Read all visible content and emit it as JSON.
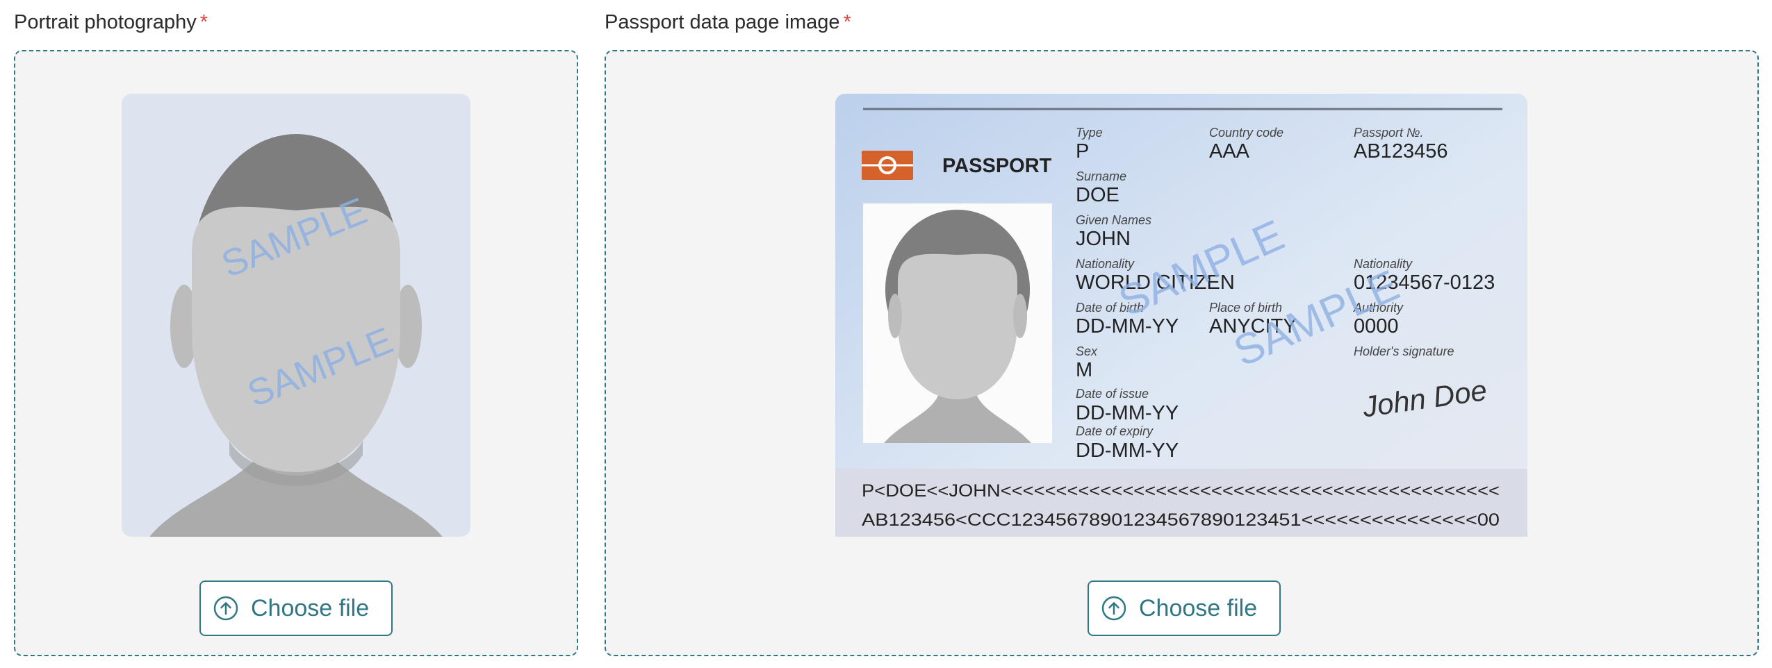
{
  "portrait": {
    "label": "Portrait photography",
    "required_mark": "*",
    "watermark": "SAMPLE",
    "button_label": "Choose file",
    "button_icon": "upload-arrow-circle-icon"
  },
  "passport": {
    "label": "Passport data page image",
    "required_mark": "*",
    "button_label": "Choose file",
    "button_icon": "upload-arrow-circle-icon",
    "document": {
      "title": "PASSPORT",
      "watermark": "SAMPLE",
      "type_label": "Type",
      "type_value": "P",
      "country_code_label": "Country code",
      "country_code_value": "AAA",
      "passport_no_label": "Passport №.",
      "passport_no_value": "AB123456",
      "surname_label": "Surname",
      "surname_value": "DOE",
      "given_names_label": "Given Names",
      "given_names_value": "JOHN",
      "nationality_label": "Nationality",
      "nationality_value": "WORLD CITIZEN",
      "personal_no_label": "Nationality",
      "personal_no_value": "01234567-0123",
      "dob_label": "Date of birth",
      "dob_value": "DD-MM-YY",
      "pob_label": "Place of birth",
      "pob_value": "ANYCITY",
      "authority_label": "Authority",
      "authority_value": "0000",
      "sex_label": "Sex",
      "sex_value": "M",
      "signature_label": "Holder's signature",
      "signature_value": "John Doe",
      "issue_label": "Date of issue",
      "issue_value": "DD-MM-YY",
      "expiry_label": "Date of expiry",
      "expiry_value": "DD-MM-YY",
      "mrz_line1": "P<DOE<<JOHN<<<<<<<<<<<<<<<<<<<<<<<<<<<<<<<<<<<<<<<<<<<<<",
      "mrz_line2": "AB123456<CCC12345678901234567890123451<<<<<<<<<<<<<<<00"
    }
  },
  "colors": {
    "accent": "#2f7784",
    "required": "#e0463d",
    "dropzone_bg": "#f4f4f4",
    "portrait_bg": "#dde4f0",
    "watermark": "#8fb1e3"
  }
}
